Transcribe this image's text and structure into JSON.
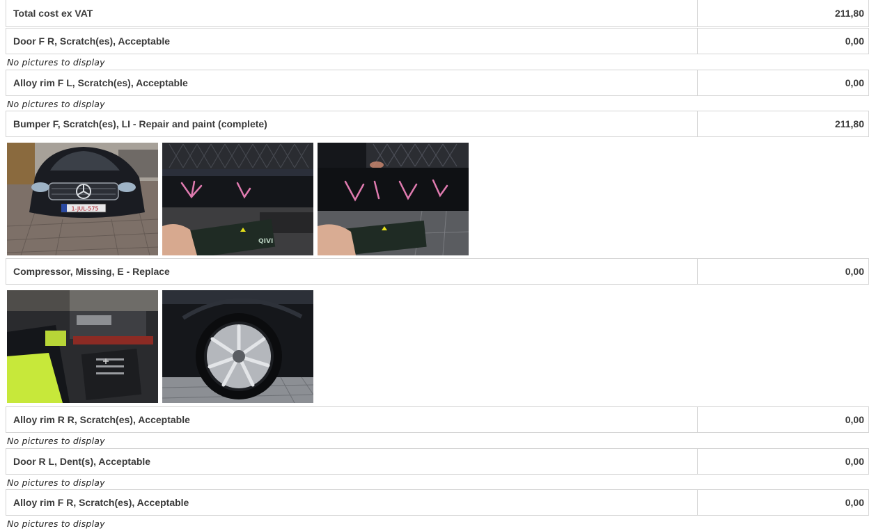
{
  "summary": {
    "label": "Total cost ex VAT",
    "amount": "211,80"
  },
  "no_pictures_text": "No pictures to display",
  "damages": [
    {
      "description": "Door F R, Scratch(es), Acceptable",
      "cost": "0,00"
    },
    {
      "description": "Alloy rim F L, Scratch(es), Acceptable",
      "cost": "0,00"
    },
    {
      "description": "Bumper F, Scratch(es), LI - Repair and paint (complete)",
      "cost": "211,80"
    },
    {
      "description": "Compressor, Missing, E - Replace",
      "cost": "0,00"
    },
    {
      "description": "Alloy rim R R, Scratch(es), Acceptable",
      "cost": "0,00"
    },
    {
      "description": "Door R L, Dent(s), Acceptable",
      "cost": "0,00"
    },
    {
      "description": "Alloy rim F R, Scratch(es), Acceptable",
      "cost": "0,00"
    }
  ],
  "photo_text": {
    "plate": "1-JUL-575",
    "card_brand": "QIVI"
  },
  "colors": {
    "border": "#d4d4d4",
    "text": "#3a3a3a",
    "marker": "#e07bb0"
  }
}
